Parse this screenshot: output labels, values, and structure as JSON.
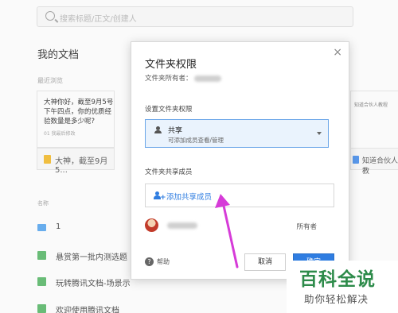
{
  "search": {
    "placeholder": "搜索标题/正文/创建人"
  },
  "page": {
    "title": "我的文档",
    "recent_label": "最近浏览",
    "card": {
      "text": "大神你好，截至9月5号下午四点，你的优质经验数量是多少呢?",
      "meta": "01 我最后修改",
      "footer": "大神，截至9月5..."
    },
    "right_card": {
      "text": "知道合伙人教程",
      "footer": "知道合伙人教"
    },
    "name_header": "名称",
    "rows": [
      {
        "label": "1"
      },
      {
        "label": "悬赏第一批内测选题"
      },
      {
        "label": "玩转腾讯文档-场景示"
      },
      {
        "label": "欢迎使用腾讯文档"
      }
    ]
  },
  "dialog": {
    "title": "文件夹权限",
    "owner_label": "文件夹所有者：",
    "section_permission": "设置文件夹权限",
    "permission_title": "共享",
    "permission_desc": "可添加成员查看/管理",
    "section_members": "文件夹共享成员",
    "add_member": "添加共享成员",
    "member_role": "所有者",
    "help": "帮助",
    "cancel": "取消",
    "confirm": "确定",
    "close": "×"
  },
  "watermark": {
    "big": "百科全说",
    "small": "助你轻松解决"
  },
  "colors": {
    "accent": "#2f7de1",
    "arrow": "#d63bd8",
    "watermark": "#2d8b4a"
  }
}
